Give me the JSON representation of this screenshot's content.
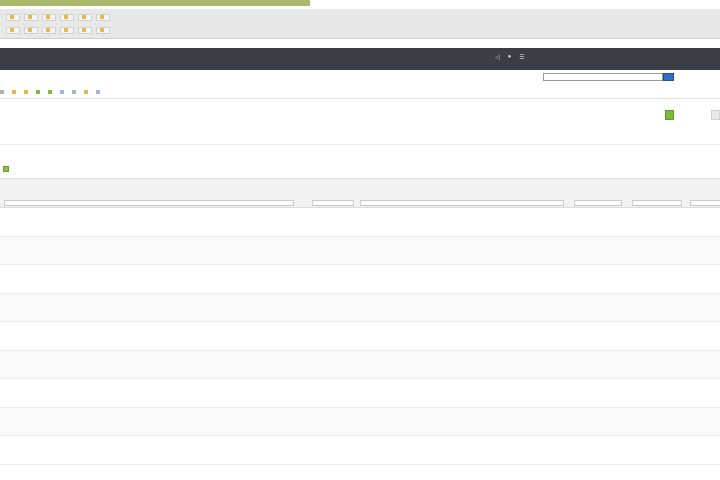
{
  "browser": {
    "bookmarks_row1": [
      "",
      "",
      "",
      "",
      "",
      ""
    ],
    "bookmarks_row2": [
      "",
      "",
      "",
      "",
      "",
      ""
    ]
  },
  "nav": {
    "items": [
      "",
      "",
      "",
      "",
      "",
      "",
      "",
      "",
      "",
      "",
      ""
    ],
    "icons": [
      "speaker-icon",
      "user-icon",
      "settings-icon"
    ]
  },
  "user": {
    "line1": "",
    "line2": ""
  },
  "search": {
    "placeholder": ""
  },
  "breadcrumbs": [
    "",
    "",
    "",
    "",
    "",
    "",
    "",
    "",
    ""
  ],
  "page": {
    "title": ""
  },
  "actions": [
    {
      "label": ""
    },
    {
      "label": ""
    }
  ],
  "filter": {
    "count_label": "",
    "link_label": ""
  },
  "grid": {
    "columns": [
      "",
      "",
      "",
      "",
      "",
      ""
    ],
    "columns_sub": [
      "",
      "",
      "",
      "",
      "",
      ""
    ],
    "rows": [
      [
        "",
        "",
        "",
        "",
        ""
      ],
      [
        "",
        "",
        "",
        "",
        ""
      ],
      [
        "",
        "",
        "",
        "",
        ""
      ],
      [
        "",
        "",
        "",
        "",
        ""
      ],
      [
        "",
        "",
        "",
        "",
        ""
      ],
      [
        "",
        "",
        "",
        "",
        ""
      ],
      [
        "",
        "",
        "",
        "",
        ""
      ],
      [
        "",
        "",
        "",
        "",
        ""
      ],
      [
        "",
        "",
        "",
        "",
        ""
      ]
    ]
  },
  "colors": {
    "navbar": "#3b3e45",
    "accent_green": "#7dbb3a",
    "search_button": "#2f6fc2",
    "load_bar": "#a9b86a"
  }
}
